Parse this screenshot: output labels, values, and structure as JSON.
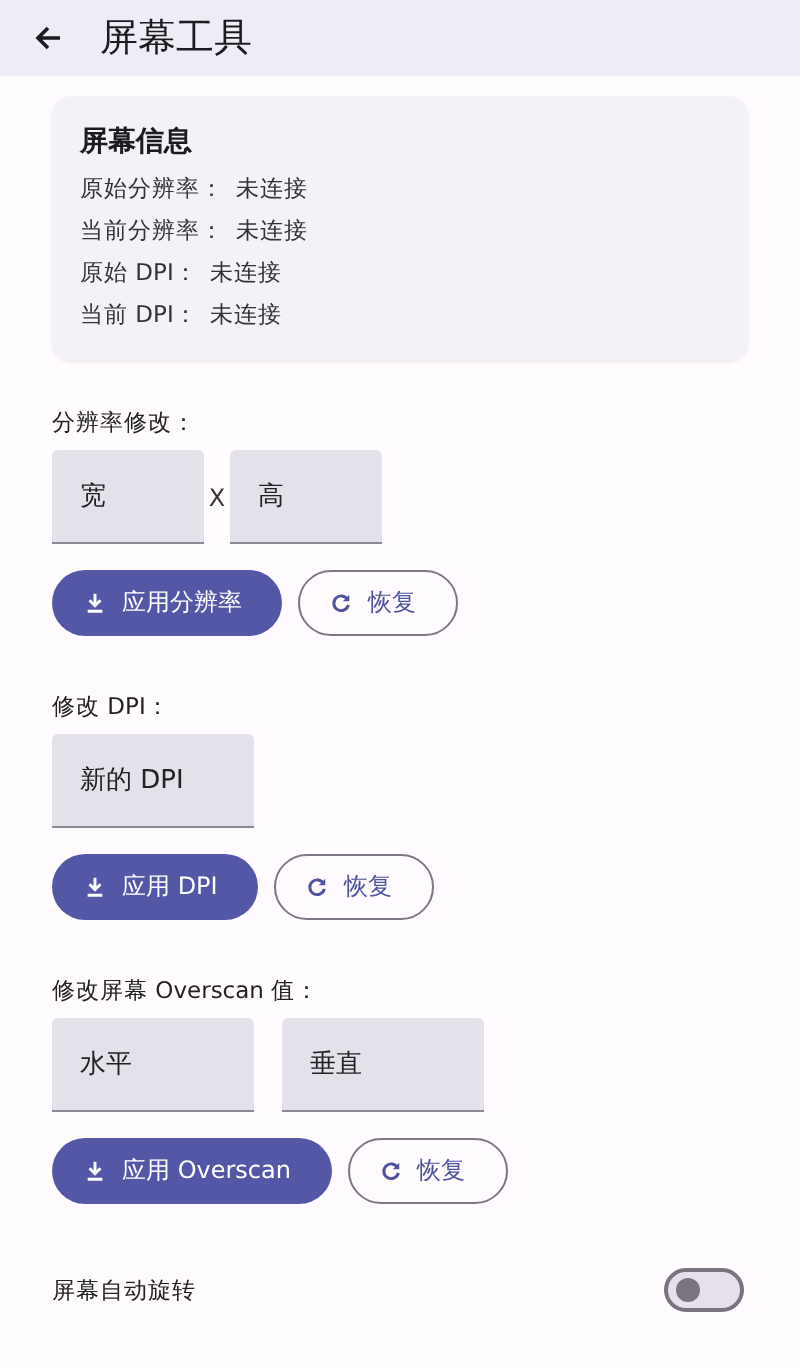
{
  "app_bar": {
    "title": "屏幕工具"
  },
  "info_card": {
    "title": "屏幕信息",
    "rows": [
      {
        "label": "原始分辨率：",
        "value": "未连接"
      },
      {
        "label": "当前分辨率：",
        "value": "未连接"
      },
      {
        "label": "原始 DPI：",
        "value": "未连接"
      },
      {
        "label": "当前 DPI：",
        "value": "未连接"
      }
    ]
  },
  "sections": [
    {
      "label": "分辨率修改：",
      "fields": [
        {
          "placeholder": "宽"
        },
        {
          "placeholder": "高"
        }
      ],
      "separator": "X",
      "apply": "应用分辨率",
      "reset": "恢复"
    },
    {
      "label": "修改 DPI：",
      "fields": [
        {
          "placeholder": "新的 DPI"
        }
      ],
      "apply": "应用 DPI",
      "reset": "恢复"
    },
    {
      "label": "修改屏幕 Overscan 值：",
      "fields": [
        {
          "placeholder": "水平"
        },
        {
          "placeholder": "垂直"
        }
      ],
      "apply": "应用 Overscan",
      "reset": "恢复"
    }
  ],
  "toggle": {
    "label": "屏幕自动旋转",
    "on": false
  }
}
